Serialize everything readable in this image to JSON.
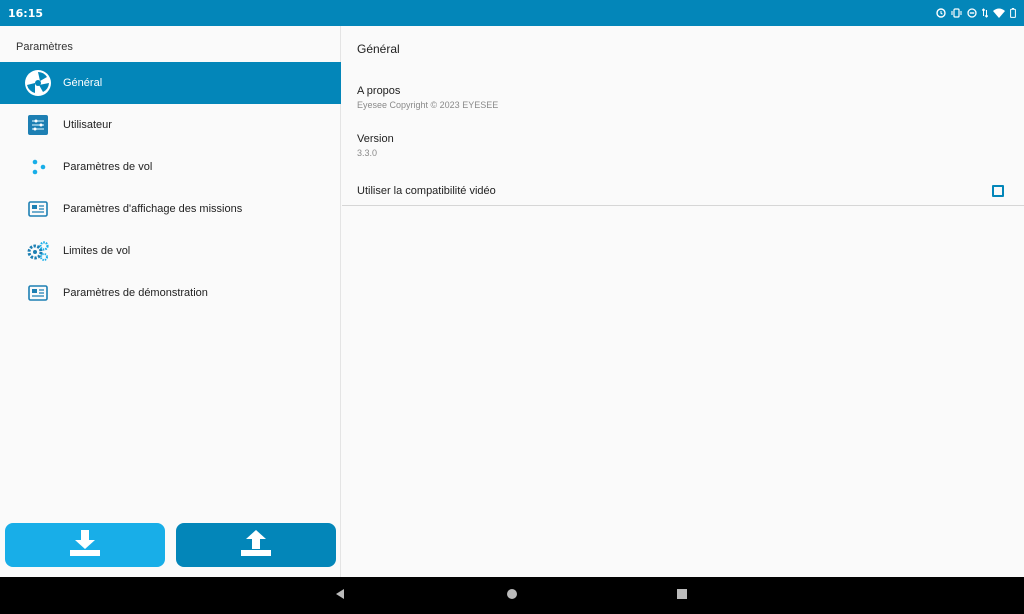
{
  "status_bar": {
    "time": "16:15",
    "icons": [
      "alarm-icon",
      "vibrate-icon",
      "do-not-disturb-icon",
      "data-arrows-icon",
      "wifi-icon",
      "battery-icon"
    ]
  },
  "sidebar": {
    "title": "Paramètres",
    "items": [
      {
        "label": "Général",
        "icon": "general-icon",
        "active": true
      },
      {
        "label": "Utilisateur",
        "icon": "user-settings-icon",
        "active": false
      },
      {
        "label": "Paramètres de vol",
        "icon": "flight-settings-icon",
        "active": false
      },
      {
        "label": "Paramètres d'affichage des missions",
        "icon": "mission-display-icon",
        "active": false
      },
      {
        "label": "Limites de vol",
        "icon": "gears-icon",
        "active": false
      },
      {
        "label": "Paramètres de démonstration",
        "icon": "demo-icon",
        "active": false
      }
    ],
    "download_button": {
      "icon": "download-icon"
    },
    "upload_button": {
      "icon": "upload-icon"
    }
  },
  "content": {
    "title": "Général",
    "about": {
      "title": "A propos",
      "summary": "Eyesee Copyright © 2023 EYESEE"
    },
    "version": {
      "title": "Version",
      "summary": "3.3.0"
    },
    "video_compat": {
      "title": "Utiliser la compatibilité vidéo",
      "checked": false
    }
  },
  "nav_bar": {
    "buttons": [
      "back-icon",
      "home-icon",
      "recents-icon"
    ]
  },
  "colors": {
    "primary": "#0386b9",
    "accent": "#18aee8",
    "background": "#fafafa",
    "nav": "#000000"
  }
}
